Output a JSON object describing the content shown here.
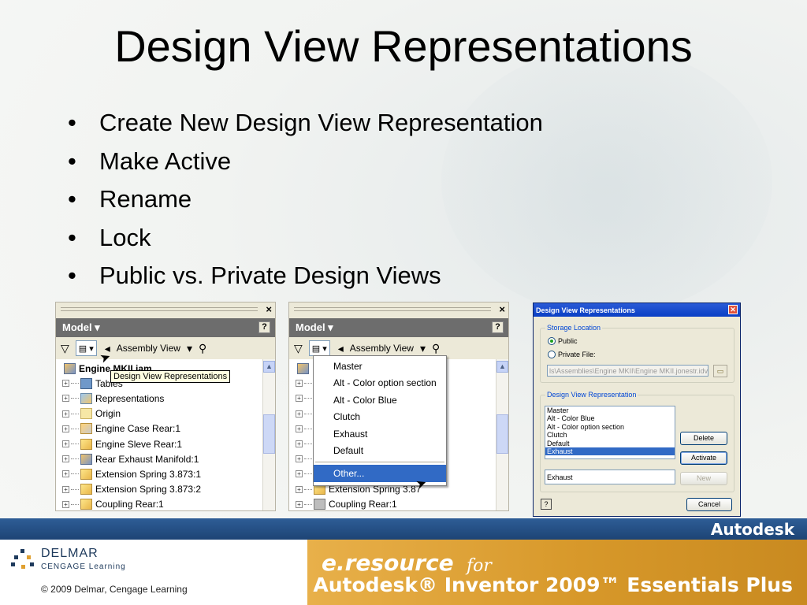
{
  "slide": {
    "title": "Design View Representations",
    "bullets": [
      "Create New Design View Representation",
      "Make Active",
      "Rename",
      "Lock",
      "Public vs. Private Design Views"
    ]
  },
  "browser_left": {
    "header": "Model ▾",
    "help": "?",
    "view_label": "Assembly View",
    "tooltip": "Design View Representations",
    "tree": [
      {
        "label": "Engine MKII.iam",
        "icon": "assembly-icon",
        "bold": true
      },
      {
        "label": "Tables",
        "icon": "table-icon"
      },
      {
        "label": "Representations",
        "icon": "representations-icon"
      },
      {
        "label": "Origin",
        "icon": "folder-icon"
      },
      {
        "label": "Engine Case Rear:1",
        "icon": "weldment-icon"
      },
      {
        "label": "Engine Sleve Rear:1",
        "icon": "part-icon"
      },
      {
        "label": "Rear Exhaust Manifold:1",
        "icon": "subassembly-icon"
      },
      {
        "label": "Extension Spring 3.873:1",
        "icon": "part-icon"
      },
      {
        "label": "Extension Spring 3.873:2",
        "icon": "part-icon"
      },
      {
        "label": "Coupling Rear:1",
        "icon": "part-icon"
      }
    ]
  },
  "browser_right": {
    "header": "Model ▾",
    "help": "?",
    "view_label": "Assembly View",
    "tree_visible": [
      {
        "label": "Extension Spring 3.87",
        "row": 8
      },
      {
        "label": "Coupling Rear:1",
        "row": 9
      }
    ],
    "dropdown": {
      "items": [
        "Master",
        "Alt - Color option section",
        "Alt - Color Blue",
        "Clutch",
        "Exhaust",
        "Default"
      ],
      "other": "Other..."
    }
  },
  "dialog": {
    "title": "Design View Representations",
    "storage_group": "Storage Location",
    "public_label": "Public",
    "private_label": "Private File:",
    "private_path": "ls\\Assemblies\\Engine MKII\\Engine MKII.jonestr.idv",
    "representation_group": "Design View Representation",
    "list": [
      "Master",
      "Alt - Color Blue",
      "Alt - Color option section",
      "Clutch",
      "Default",
      "Exhaust"
    ],
    "selected": "Exhaust",
    "name_field": "Exhaust",
    "delete_label": "Delete",
    "activate_label": "Activate",
    "new_label": "New",
    "cancel_label": "Cancel",
    "help": "?"
  },
  "footer": {
    "brand": "Autodesk",
    "publisher": "DELMAR",
    "publisher_sub": "CENGAGE Learning",
    "copyright": "© 2009  Delmar, Cengage Learning",
    "eresource": "e.resource",
    "for": "for",
    "product": "Autodesk® Inventor 2009™ Essentials Plus"
  },
  "colors": {
    "footer_blue": "#1d4475",
    "footer_gold": "#d7982a",
    "selection": "#316ac5"
  }
}
